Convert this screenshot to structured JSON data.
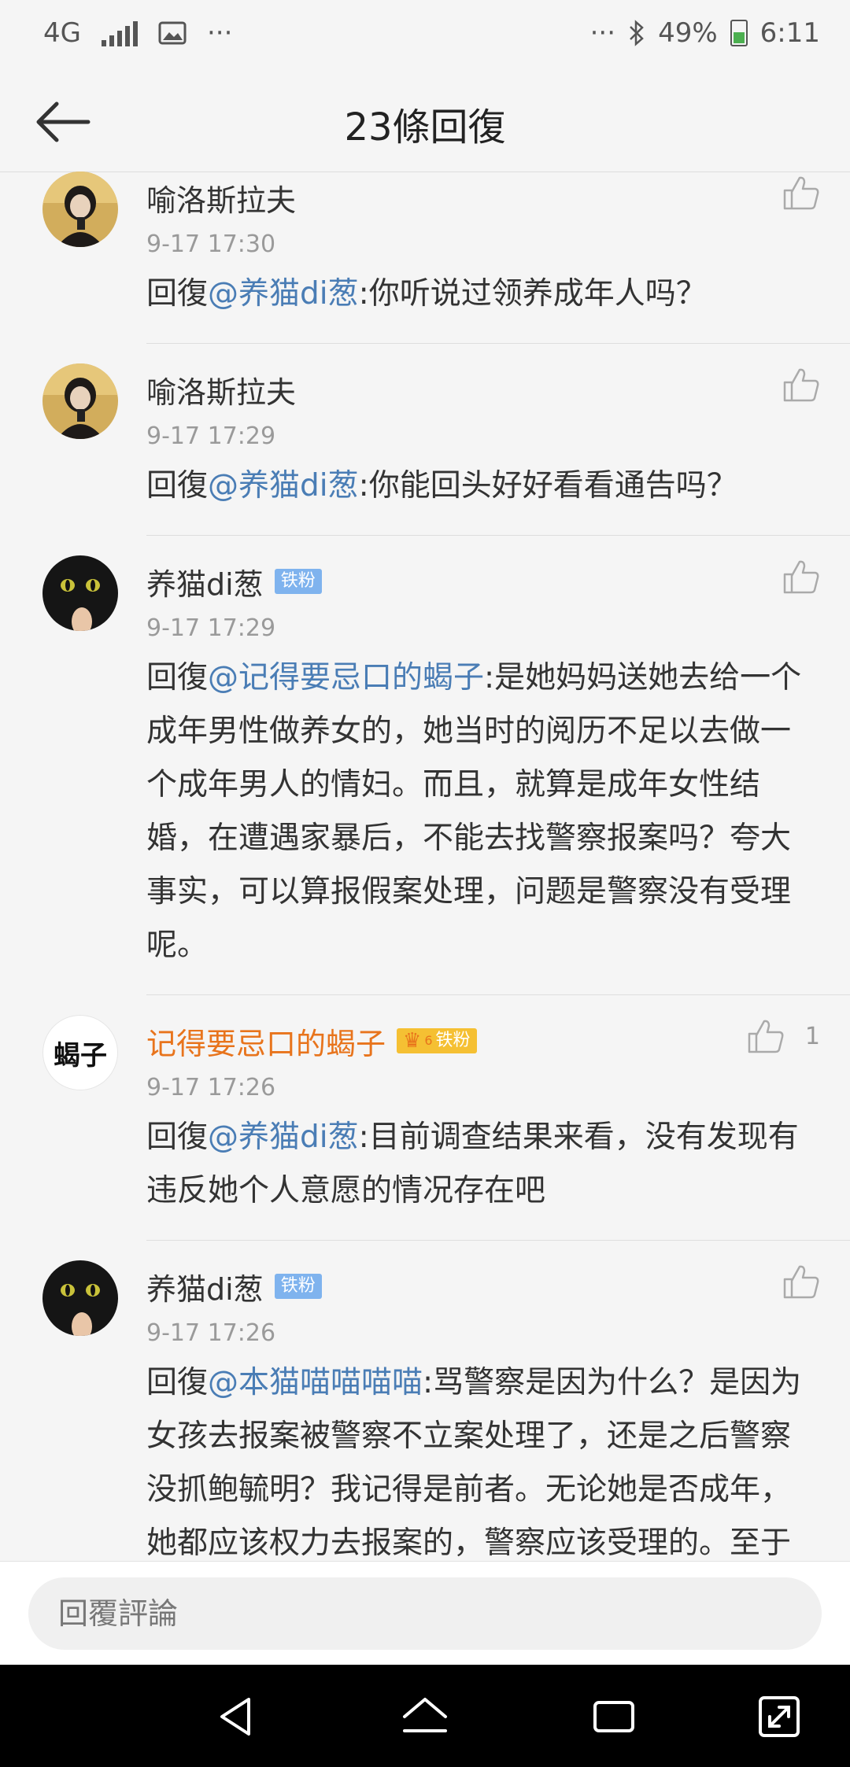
{
  "status_bar": {
    "network": "4G",
    "more_left": "···",
    "more_right": "···",
    "battery": "49%",
    "time": "6:11"
  },
  "header": {
    "title": "23條回復"
  },
  "comments": [
    {
      "author": "喻洛斯拉夫",
      "time": "9-17 17:30",
      "reply_prefix": "回復",
      "mention": "@养猫di葱",
      "text": ":你听说过领养成年人吗？"
    },
    {
      "author": "喻洛斯拉夫",
      "time": "9-17 17:29",
      "reply_prefix": "回復",
      "mention": "@养猫di葱",
      "text": ":你能回头好好看看通告吗？"
    },
    {
      "author": "养猫di葱",
      "badge": "铁粉",
      "time": "9-17 17:29",
      "reply_prefix": "回復",
      "mention": "@记得要忌口的蝎子",
      "text": ":是她妈妈送她去给一个成年男性做养女的，她当时的阅历不足以去做一个成年男人的情妇。而且，就算是成年女性结婚，在遭遇家暴后，不能去找警察报案吗？夸大事实，可以算报假案处理，问题是警察没有受理呢。"
    },
    {
      "author": "记得要忌口的蝎子",
      "badge": "铁粉",
      "badge_level": "6",
      "avatar_text": "蝎子",
      "like_count": "1",
      "time": "9-17 17:26",
      "reply_prefix": "回復",
      "mention": "@养猫di葱",
      "text": ":目前调查结果来看，没有发现有违反她个人意愿的情况存在吧"
    },
    {
      "author": "养猫di葱",
      "badge": "铁粉",
      "time": "9-17 17:26",
      "reply_prefix": "回復",
      "mention": "@本猫喵喵喵喵",
      "text": ":骂警察是因为什么？是因为女孩去报案被警察不立案处理了，还是之后警察没抓鲍毓明？我记得是前者。无论她是否成年，她都应该权力去报案的，警察应该受理的。至于后面是真是假都可以处理。"
    }
  ],
  "reply_bar": {
    "placeholder": "回覆評論"
  },
  "colors": {
    "mention": "#4a7db5",
    "vip_name": "#e8741c",
    "fan_badge": "#7fb3ee",
    "gold_badge": "#f5c033"
  }
}
